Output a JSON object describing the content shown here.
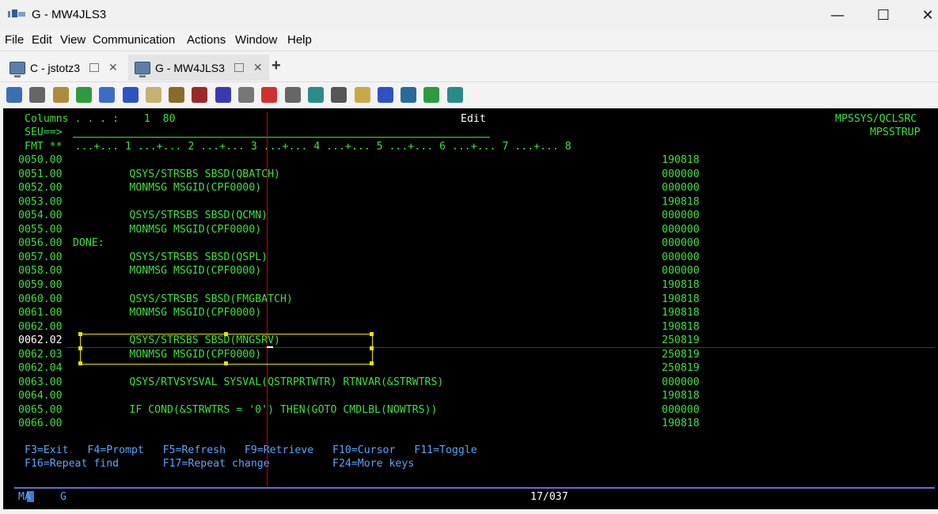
{
  "window": {
    "title": "G - MW4JLS3",
    "controls": {
      "minimize": "—",
      "maximize": "☐",
      "close": "✕"
    }
  },
  "menu": [
    {
      "label": "File"
    },
    {
      "label": "Edit"
    },
    {
      "label": "View"
    },
    {
      "label": "Communication"
    },
    {
      "label": "Actions"
    },
    {
      "label": "Window"
    },
    {
      "label": "Help"
    }
  ],
  "tabs": [
    {
      "label": "C - jstotz3",
      "active": false
    },
    {
      "label": "G - MW4JLS3",
      "active": true
    }
  ],
  "new_tab_label": "+",
  "toolbar_icons": [
    {
      "name": "copy-append-icon",
      "color": "#3c6fb0"
    },
    {
      "name": "copy-icon",
      "color": "#666666"
    },
    {
      "name": "paste-icon",
      "color": "#b08a3c"
    },
    {
      "name": "receive-file-icon",
      "color": "#2e9a3e"
    },
    {
      "name": "save-icon",
      "color": "#3d6cc7"
    },
    {
      "name": "navigator-icon",
      "color": "#2f52c2"
    },
    {
      "name": "notes-icon",
      "color": "#c8b070"
    },
    {
      "name": "package-icon",
      "color": "#8a6a2a"
    },
    {
      "name": "macro-icon",
      "color": "#9a2a2a"
    },
    {
      "name": "keypad-icon",
      "color": "#3a3ab0"
    },
    {
      "name": "edit-tools-icon",
      "color": "#777777"
    },
    {
      "name": "record-macro-icon",
      "color": "#d03030"
    },
    {
      "name": "stop-icon",
      "color": "#666666"
    },
    {
      "name": "play-macro-icon",
      "color": "#2e8a8a"
    },
    {
      "name": "print-screen-icon",
      "color": "#555555"
    },
    {
      "name": "clipboard-icon",
      "color": "#c9a84a"
    },
    {
      "name": "help-icon",
      "color": "#2f52c2"
    },
    {
      "name": "settings-icon",
      "color": "#2a6a9a"
    },
    {
      "name": "send-file-icon",
      "color": "#2e9a3e"
    },
    {
      "name": "screen-capture-icon",
      "color": "#2a8a8a"
    }
  ],
  "terminal": {
    "columns_line": "Columns . . . :    1  80",
    "mode": "Edit",
    "source_file": "MPSSYS/QCLSRC",
    "member": "MPSSTRUP",
    "seu_prompt": "SEU==>",
    "fmt_line": "FMT **  ...+... 1 ...+... 2 ...+... 3 ...+... 4 ...+... 5 ...+... 6 ...+... 7 ...+... 8",
    "lines": [
      {
        "seq": "0050.00",
        "text": "",
        "date": "190818",
        "highlight": false
      },
      {
        "seq": "0051.00",
        "text": "          QSYS/STRSBS SBSD(QBATCH)",
        "date": "000000",
        "highlight": false
      },
      {
        "seq": "0052.00",
        "text": "          MONMSG MSGID(CPF0000)",
        "date": "000000",
        "highlight": false
      },
      {
        "seq": "0053.00",
        "text": "",
        "date": "190818",
        "highlight": false
      },
      {
        "seq": "0054.00",
        "text": "          QSYS/STRSBS SBSD(QCMN)",
        "date": "000000",
        "highlight": false
      },
      {
        "seq": "0055.00",
        "text": "          MONMSG MSGID(CPF0000)",
        "date": "000000",
        "highlight": false
      },
      {
        "seq": "0056.00",
        "text": " DONE:",
        "date": "000000",
        "highlight": false
      },
      {
        "seq": "0057.00",
        "text": "          QSYS/STRSBS SBSD(QSPL)",
        "date": "000000",
        "highlight": false
      },
      {
        "seq": "0058.00",
        "text": "          MONMSG MSGID(CPF0000)",
        "date": "000000",
        "highlight": false
      },
      {
        "seq": "0059.00",
        "text": "",
        "date": "190818",
        "highlight": false
      },
      {
        "seq": "0060.00",
        "text": "          QSYS/STRSBS SBSD(FMGBATCH)",
        "date": "190818",
        "highlight": false
      },
      {
        "seq": "0061.00",
        "text": "          MONMSG MSGID(CPF0000)",
        "date": "190818",
        "highlight": false
      },
      {
        "seq": "0062.00",
        "text": "",
        "date": "190818",
        "highlight": false
      },
      {
        "seq": "0062.02",
        "text": "          QSYS/STRSBS SBSD(MNGSRV)",
        "date": "250819",
        "highlight": true
      },
      {
        "seq": "0062.03",
        "text": "          MONMSG MSGID(CPF0000)",
        "date": "250819",
        "highlight": false
      },
      {
        "seq": "0062.04",
        "text": "",
        "date": "250819",
        "highlight": false
      },
      {
        "seq": "0063.00",
        "text": "          QSYS/RTVSYSVAL SYSVAL(QSTRPRTWTR) RTNVAR(&STRWTRS)",
        "date": "000000",
        "highlight": false
      },
      {
        "seq": "0064.00",
        "text": "",
        "date": "190818",
        "highlight": false
      },
      {
        "seq": "0065.00",
        "text": "          IF COND(&STRWTRS = '0') THEN(GOTO CMDLBL(NOWTRS))",
        "date": "000000",
        "highlight": false
      },
      {
        "seq": "0066.00",
        "text": "",
        "date": "190818",
        "highlight": false
      }
    ],
    "fkeys_row1": "F3=Exit   F4=Prompt   F5=Refresh   F9=Retrieve   F10=Cursor   F11=Toggle",
    "fkeys_row2": "F16=Repeat find       F17=Repeat change          F24=More keys",
    "status": {
      "ma": "MA",
      "session": "G",
      "position": "17/037"
    }
  }
}
